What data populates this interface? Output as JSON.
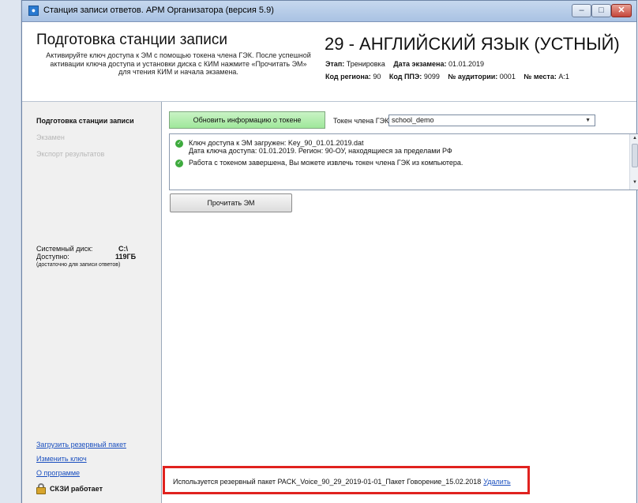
{
  "window": {
    "title": "Станция записи ответов. АРМ Организатора (версия 5.9)",
    "controls": {
      "minimize": "–",
      "maximize": "□",
      "close": "✕"
    }
  },
  "header": {
    "title": "Подготовка станции записи",
    "description": "Активируйте ключ доступа к ЭМ с помощью токена члена ГЭК. После успешной активации ключа доступа и установки диска с КИМ нажмите «Прочитать ЭМ» для чтения КИМ и начала экзамена.",
    "subject": "29 - АНГЛИЙСКИЙ ЯЗЫК (УСТНЫЙ)",
    "stage_label": "Этап:",
    "stage_value": "Тренировка",
    "date_label": "Дата экзамена:",
    "date_value": "01.01.2019",
    "region_label": "Код региона:",
    "region_value": "90",
    "ppe_label": "Код ППЭ:",
    "ppe_value": "9099",
    "room_label": "№ аудитории:",
    "room_value": "0001",
    "seat_label": "№ места:",
    "seat_value": "A:1"
  },
  "sidebar": {
    "items": [
      {
        "label": "Подготовка станции записи",
        "state": "active"
      },
      {
        "label": "Экзамен",
        "state": "disabled"
      },
      {
        "label": "Экспорт результатов",
        "state": "disabled"
      }
    ],
    "disk": {
      "system_label": "Системный диск:",
      "system_value": "C:\\",
      "free_label": "Доступно:",
      "free_value": "119ГБ",
      "note": "(достаточно для записи ответов)"
    },
    "links": {
      "load_backup": "Загрузить резервный пакет",
      "change_key": "Изменить ключ",
      "about": "О программе"
    },
    "skzi_status": "СКЗИ работает"
  },
  "main": {
    "update_token_button": "Обновить информацию о токене",
    "token_label": "Токен члена ГЭК",
    "token_value": "school_demo",
    "log": [
      {
        "line1": "Ключ доступа к ЭМ загружен: Key_90_01.01.2019.dat",
        "line2": "Дата ключа доступа: 01.01.2019. Регион: 90-ОУ, находящиеся за пределами РФ"
      },
      {
        "line1": "Работа с токеном завершена, Вы можете извлечь токен члена ГЭК из компьютера.",
        "line2": ""
      }
    ],
    "read_button": "Прочитать ЭМ",
    "status_text": "Используется резервный пакет PACK_Voice_90_29_2019-01-01_Пакет Говорение_15.02.2018",
    "status_link": "Удалить"
  },
  "colors": {
    "green_button": "#a6e9a1",
    "highlight_border": "#e0221f",
    "link": "#1a4fbf"
  }
}
